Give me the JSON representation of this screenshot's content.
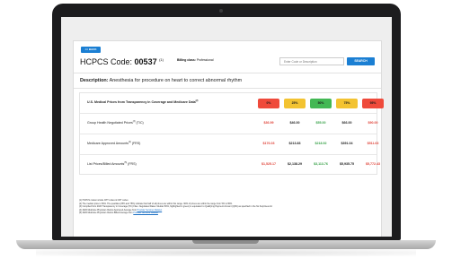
{
  "header": {
    "back_label": "<< BACK",
    "hcpcs_prefix": "HCPCS Code:",
    "hcpcs_code": "00537",
    "hcpcs_note": "(1)",
    "billing_label": "Billing class:",
    "billing_value": "Professional",
    "search_placeholder": "Enter Code or Description",
    "search_button": "SEARCH"
  },
  "description": {
    "label": "Description:",
    "text": "Anesthesia for procedure on heart to correct abnormal rhythm"
  },
  "table": {
    "header_label": "U.S. Medical Prices from Transparency in Coverage and Medicare Data",
    "header_note": "(2)",
    "percentiles": [
      {
        "label": "0%",
        "color": "#ef4a3b"
      },
      {
        "label": "25%",
        "color": "#f3c331"
      },
      {
        "label": "50%",
        "color": "#43b854"
      },
      {
        "label": "75%",
        "color": "#f3c331"
      },
      {
        "label": "95%",
        "color": "#ef4a3b"
      }
    ],
    "rows": [
      {
        "label": "Group Health Negotiated Prices",
        "note": "(3)",
        "suffix": " (TIC)",
        "values": [
          "$36.99",
          "$46.00",
          "$55.00",
          "$66.00",
          "$90.00"
        ]
      },
      {
        "label": "Medicare Approved Amounts",
        "note": "(4)",
        "suffix": " (FRS)",
        "values": [
          "$176.03",
          "$213.83",
          "$218.92",
          "$391.04",
          "$511.63"
        ]
      },
      {
        "label": "List Prices/Billed Amounts",
        "note": "(5)",
        "suffix": " (FRS)",
        "values": [
          "$1,525.17",
          "$2,138.29",
          "$3,113.76",
          "$5,935.75",
          "$5,772.43"
        ]
      }
    ]
  },
  "footnotes": [
    "(1) HCPCS codes include CPT codes & CDT codes",
    "(2) The median price is 50%. The quartiles (25% and 75%) indicate that half of all prices are within this range. 90% of prices are within the range from 5% to 95%.",
    "(3) Compiled from 2023 Transparency in Coverage (TiC) Files. Negotiated Rates: Median 50%, highlighted in green) is equivalent to Qualifying Payment Amount (QPA) as specified in the No Surprises Act",
    "(4) 2020 Medicare Physician Claims Approved Average from",
    "(5) 2020 Medicare Physician Claims Billed Average from"
  ],
  "footnote_links": [
    "Provider Services Dataset",
    "Provider Services Dataset"
  ]
}
